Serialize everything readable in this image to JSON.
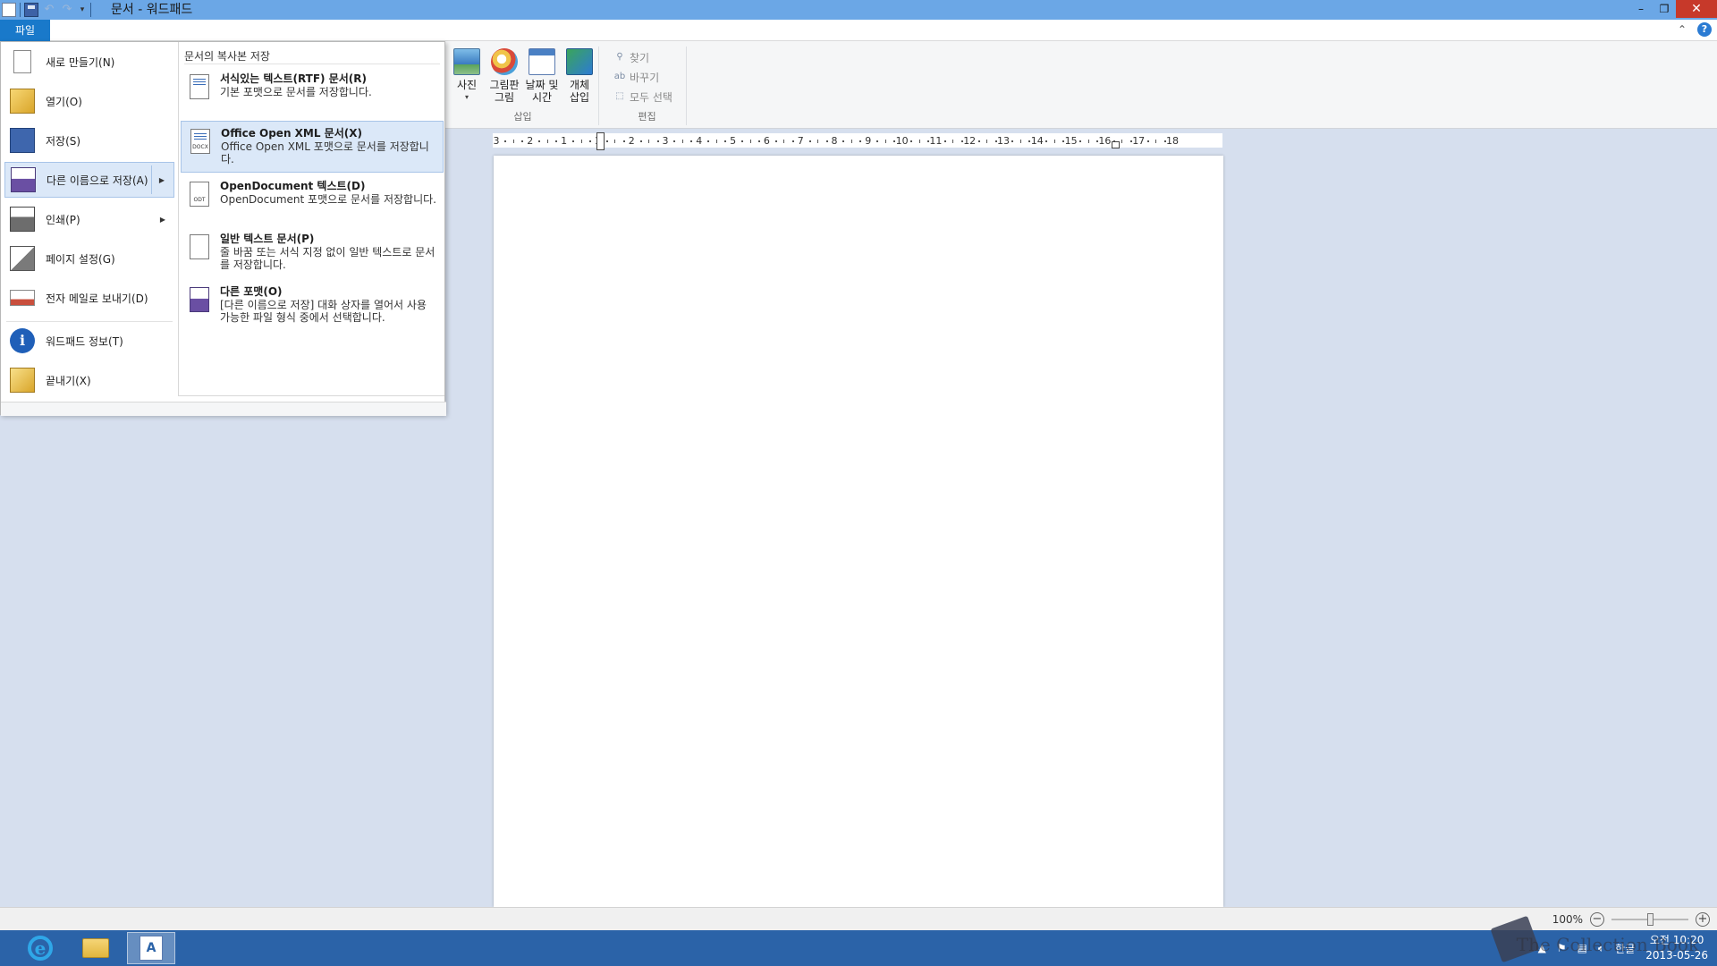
{
  "window": {
    "title": "문서 - 워드패드"
  },
  "ribbon": {
    "file_tab": "파일",
    "insert": {
      "photo": "사진",
      "paint_1": "그림판",
      "paint_2": "그림",
      "datetime_1": "날짜 및",
      "datetime_2": "시간",
      "object_1": "개체",
      "object_2": "삽입",
      "group_label": "삽입"
    },
    "edit": {
      "find": "찾기",
      "replace": "바꾸기",
      "select_all": "모두 선택",
      "group_label": "편집"
    }
  },
  "file_menu": {
    "items": [
      {
        "label": "새로 만들기(N)"
      },
      {
        "label": "열기(O)"
      },
      {
        "label": "저장(S)"
      },
      {
        "label": "다른 이름으로 저장(A)"
      },
      {
        "label": "인쇄(P)"
      },
      {
        "label": "페이지 설정(G)"
      },
      {
        "label": "전자 메일로 보내기(D)"
      },
      {
        "label": "워드패드 정보(T)"
      },
      {
        "label": "끝내기(X)"
      }
    ],
    "save_as_heading": "문서의 복사본 저장",
    "save_as_options": [
      {
        "title": "서식있는 텍스트(RTF) 문서(R)",
        "desc": "기본 포맷으로 문서를 저장합니다.",
        "icon_text": ""
      },
      {
        "title": "Office Open XML 문서(X)",
        "desc": "Office Open XML 포맷으로 문서를 저장합니다.",
        "icon_text": "DOCX"
      },
      {
        "title": "OpenDocument 텍스트(D)",
        "desc": "OpenDocument 포맷으로 문서를 저장합니다.",
        "icon_text": "ODT"
      },
      {
        "title": "일반 텍스트 문서(P)",
        "desc": "줄 바꿈 또는 서식 지정 없이 일반 텍스트로 문서를 저장합니다.",
        "icon_text": ""
      },
      {
        "title": "다른 포맷(O)",
        "desc": "[다른 이름으로 저장] 대화 상자를 열어서 사용 가능한 파일 형식 중에서 선택합니다.",
        "icon_text": ""
      }
    ]
  },
  "ruler": {
    "labels": [
      "3",
      "2",
      "1",
      "1",
      "2",
      "3",
      "4",
      "5",
      "6",
      "7",
      "8",
      "9",
      "10",
      "11",
      "12",
      "13",
      "14",
      "15",
      "16",
      "17",
      "18"
    ]
  },
  "statusbar": {
    "zoom": "100%",
    "zoom_out": "−",
    "zoom_in": "+",
    "zoom_level": 0.5
  },
  "taskbar": {
    "ie": "e",
    "wordpad": "A",
    "ime": "한글",
    "time": "오전 10:20",
    "date": "2013-05-26",
    "watermark": "The Collection Book"
  }
}
